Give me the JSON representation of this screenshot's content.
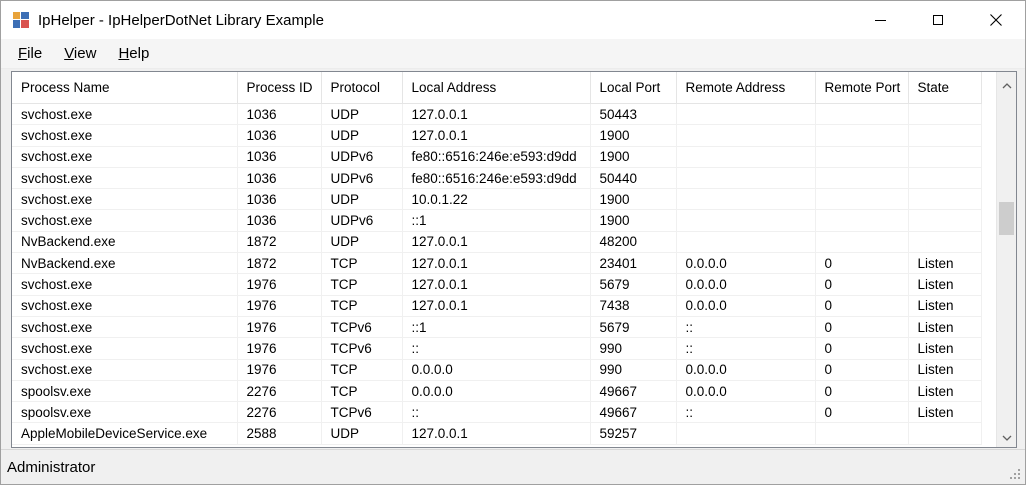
{
  "window": {
    "title": "IpHelper - IpHelperDotNet Library Example"
  },
  "menu": [
    {
      "hotkey": "F",
      "rest": "ile"
    },
    {
      "hotkey": "V",
      "rest": "iew"
    },
    {
      "hotkey": "H",
      "rest": "elp"
    }
  ],
  "table": {
    "columns": [
      "Process Name",
      "Process ID",
      "Protocol",
      "Local Address",
      "Local Port",
      "Remote Address",
      "Remote Port",
      "State"
    ],
    "rows": [
      [
        "svchost.exe",
        "1036",
        "UDP",
        "127.0.0.1",
        "50443",
        "",
        "",
        ""
      ],
      [
        "svchost.exe",
        "1036",
        "UDP",
        "127.0.0.1",
        "1900",
        "",
        "",
        ""
      ],
      [
        "svchost.exe",
        "1036",
        "UDPv6",
        "fe80::6516:246e:e593:d9dd",
        "1900",
        "",
        "",
        ""
      ],
      [
        "svchost.exe",
        "1036",
        "UDPv6",
        "fe80::6516:246e:e593:d9dd",
        "50440",
        "",
        "",
        ""
      ],
      [
        "svchost.exe",
        "1036",
        "UDP",
        "10.0.1.22",
        "1900",
        "",
        "",
        ""
      ],
      [
        "svchost.exe",
        "1036",
        "UDPv6",
        "::1",
        "1900",
        "",
        "",
        ""
      ],
      [
        "NvBackend.exe",
        "1872",
        "UDP",
        "127.0.0.1",
        "48200",
        "",
        "",
        ""
      ],
      [
        "NvBackend.exe",
        "1872",
        "TCP",
        "127.0.0.1",
        "23401",
        "0.0.0.0",
        "0",
        "Listen"
      ],
      [
        "svchost.exe",
        "1976",
        "TCP",
        "127.0.0.1",
        "5679",
        "0.0.0.0",
        "0",
        "Listen"
      ],
      [
        "svchost.exe",
        "1976",
        "TCP",
        "127.0.0.1",
        "7438",
        "0.0.0.0",
        "0",
        "Listen"
      ],
      [
        "svchost.exe",
        "1976",
        "TCPv6",
        "::1",
        "5679",
        "::",
        "0",
        "Listen"
      ],
      [
        "svchost.exe",
        "1976",
        "TCPv6",
        "::",
        "990",
        "::",
        "0",
        "Listen"
      ],
      [
        "svchost.exe",
        "1976",
        "TCP",
        "0.0.0.0",
        "990",
        "0.0.0.0",
        "0",
        "Listen"
      ],
      [
        "spoolsv.exe",
        "2276",
        "TCP",
        "0.0.0.0",
        "49667",
        "0.0.0.0",
        "0",
        "Listen"
      ],
      [
        "spoolsv.exe",
        "2276",
        "TCPv6",
        "::",
        "49667",
        "::",
        "0",
        "Listen"
      ],
      [
        "AppleMobileDeviceService.exe",
        "2588",
        "UDP",
        "127.0.0.1",
        "59257",
        "",
        "",
        ""
      ]
    ]
  },
  "statusbar": {
    "text": "Administrator"
  },
  "icons": {
    "app": "app-grid-icon",
    "minimize": "minimize-icon",
    "maximize": "maximize-icon",
    "close": "close-icon",
    "scroll_up": "chevron-up-icon",
    "scroll_down": "chevron-down-icon",
    "grip": "resize-grip-icon"
  }
}
